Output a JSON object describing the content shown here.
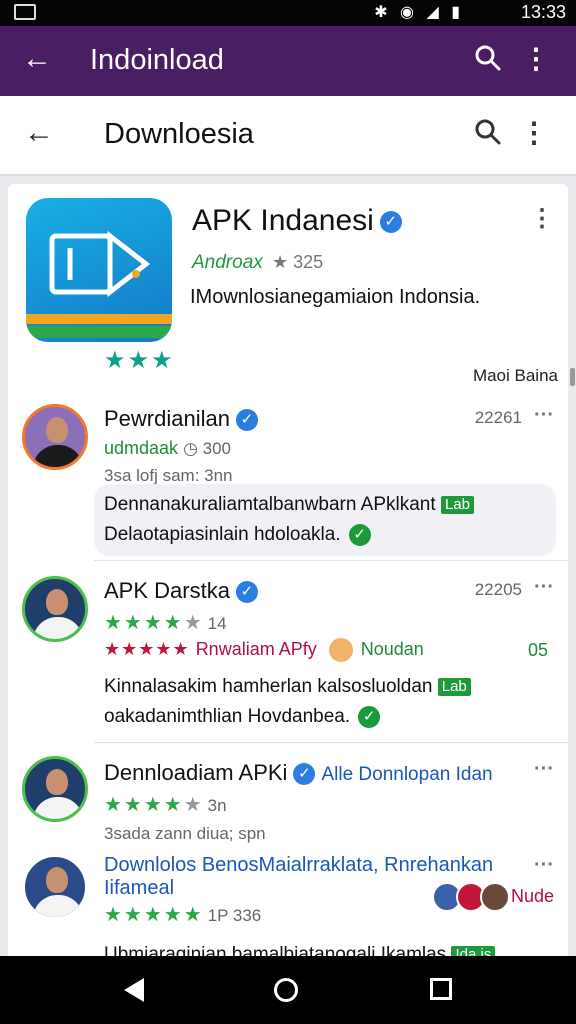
{
  "status_bar": {
    "time": "13:33",
    "icons": "✱ ◉ ◢ ▮"
  },
  "header_primary": {
    "title": "Indoinload"
  },
  "header_secondary": {
    "title": "Downloesia"
  },
  "app": {
    "name": "APK Indanesi",
    "developer": "Androax",
    "count": "★ 325",
    "description": "IMownlosianegamiaion Indonsia.",
    "stars": "★★★",
    "more_label": "Maoi Baina"
  },
  "reviews": [
    {
      "name": "Pewrdianilan",
      "date": "22261",
      "sub": "udmdaak",
      "sub_count": "◷ 300",
      "meta": "3sa lofj sam: 3nn",
      "text_line1": "Dennanakuraliamtalbanwbarn APklkant",
      "tag1": "Lab",
      "text_line2": "Delaotapiasinlain hdoloakla."
    },
    {
      "name": "APK Darstka",
      "date": "22205",
      "stars": "★★★★",
      "stars_gray": "★",
      "count": "14",
      "red_stars": "★★★★★",
      "red_text": "Rnwaliam APfy",
      "green_text": "Noudan",
      "badge": "05",
      "text_line1": "Kinnalasakim hamherlan kalsosluoldan",
      "tag1": "Lab",
      "text_line2": "oakadanimthlian Hovdanbea."
    },
    {
      "name": "Dennloadiam APKi",
      "link": "Alle Donnlopan Idan",
      "stars": "★★★★",
      "stars_gray": "★",
      "count": "3n",
      "meta": "3sada zann diua; spn"
    },
    {
      "name": "Downlolos BenosMaialrraklata, Rnrehankan",
      "name2": "Iifameal",
      "stars": "★★★★★",
      "count": "1P 336",
      "label": "Nude",
      "text_line1": "Ubmiaraqinian bamalbiatanogali Ikamlas",
      "tag1": "Ida is"
    }
  ],
  "colors": {
    "primary": "#4a1e63",
    "accent_green": "#2aa84a",
    "verified_blue": "#2b7de0"
  }
}
